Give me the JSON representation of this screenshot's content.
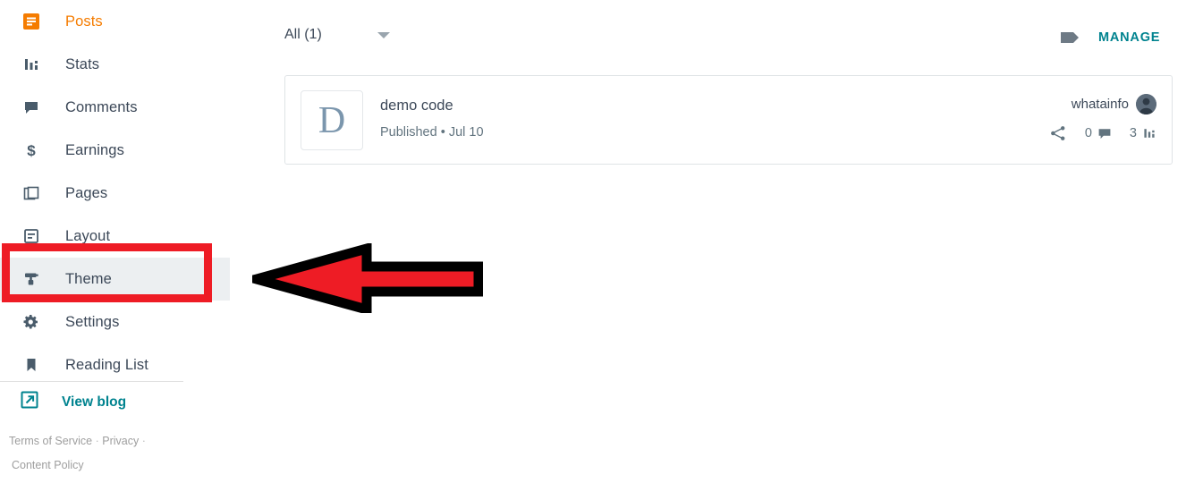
{
  "sidebar": {
    "items": [
      {
        "label": "Posts",
        "icon": "posts-icon",
        "state": "active"
      },
      {
        "label": "Stats",
        "icon": "stats-icon",
        "state": "normal"
      },
      {
        "label": "Comments",
        "icon": "comments-icon",
        "state": "normal"
      },
      {
        "label": "Earnings",
        "icon": "earnings-icon",
        "state": "normal"
      },
      {
        "label": "Pages",
        "icon": "pages-icon",
        "state": "normal"
      },
      {
        "label": "Layout",
        "icon": "layout-icon",
        "state": "normal"
      },
      {
        "label": "Theme",
        "icon": "theme-icon",
        "state": "selected"
      },
      {
        "label": "Settings",
        "icon": "settings-icon",
        "state": "normal"
      },
      {
        "label": "Reading List",
        "icon": "reading-list-icon",
        "state": "normal"
      }
    ],
    "view_blog": {
      "label": "View blog",
      "icon": "external-link-icon"
    },
    "footer": {
      "terms": "Terms of Service",
      "privacy": "Privacy",
      "content_policy": "Content Policy",
      "separator": "·"
    }
  },
  "toolbar": {
    "filter_label": "All (1)",
    "filter_icon": "chevron-down-icon",
    "tag_icon": "label-tag-icon",
    "manage_label": "MANAGE"
  },
  "post": {
    "thumbnail_letter": "D",
    "title": "demo code",
    "status": "Published",
    "separator": "•",
    "date": "Jul 10",
    "author": "whatainfo",
    "share_icon": "share-icon",
    "comment_count": "0",
    "comment_icon": "comment-icon",
    "view_count": "3",
    "stats_icon": "stats-bar-icon"
  },
  "annotations": {
    "highlight_target": "Theme",
    "highlight_color": "#ee1c25",
    "arrow_color": "#ee1c25",
    "arrow_direction": "left"
  },
  "colors": {
    "accent_orange": "#f57c00",
    "accent_teal": "#00838f",
    "text_primary": "#3c4858",
    "text_secondary": "#62747f",
    "selected_bg": "#eceff1"
  }
}
